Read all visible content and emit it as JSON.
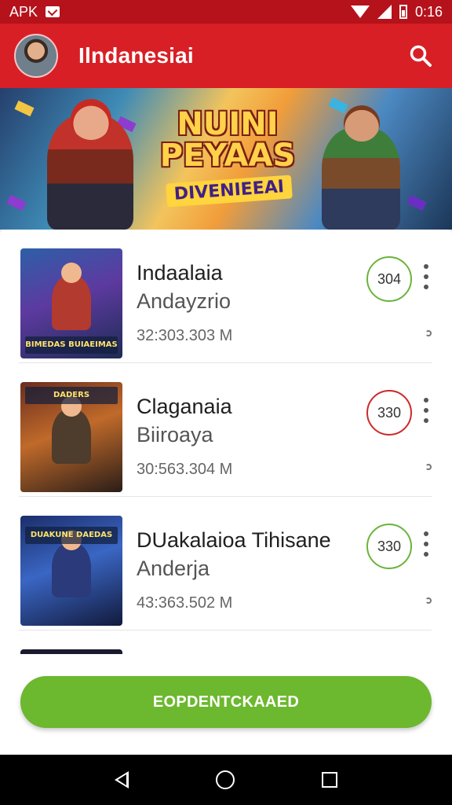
{
  "status_bar": {
    "left_text": "APK",
    "time": "0:16"
  },
  "app_bar": {
    "title": "Ilndanesiai"
  },
  "banner": {
    "title": "NUINI PEYAAS",
    "subtitle": "DIVENIEEAI"
  },
  "items": [
    {
      "title": "Indaalaia",
      "subtitle": "Andayzrio",
      "size": "32:303.303 M",
      "score": "304",
      "score_color": "#6bb43c",
      "thumb_label": "BIMEDAS BUIAEIMAS"
    },
    {
      "title": "Claganaia",
      "subtitle": "Biiroaya",
      "size": "30:563.304 M",
      "score": "330",
      "score_color": "#cc2a2a",
      "thumb_label": "DADERS"
    },
    {
      "title": "DUakalaioa Tihisane",
      "subtitle": "Anderja",
      "size": "43:363.502 M",
      "score": "330",
      "score_color": "#6bb43c",
      "thumb_label": "DUAKUNE DAEDAS"
    }
  ],
  "primary_button": {
    "label": "EOPDENTCKAAED"
  },
  "colors": {
    "app_bar": "#d81f26",
    "status_bar": "#b5121b",
    "accent_green": "#6cb82e"
  },
  "icons": [
    "mail-icon",
    "wifi-icon",
    "signal-icon",
    "battery-icon",
    "search-icon",
    "more-vert-icon",
    "nav-back-icon",
    "nav-home-icon",
    "nav-recent-icon"
  ]
}
